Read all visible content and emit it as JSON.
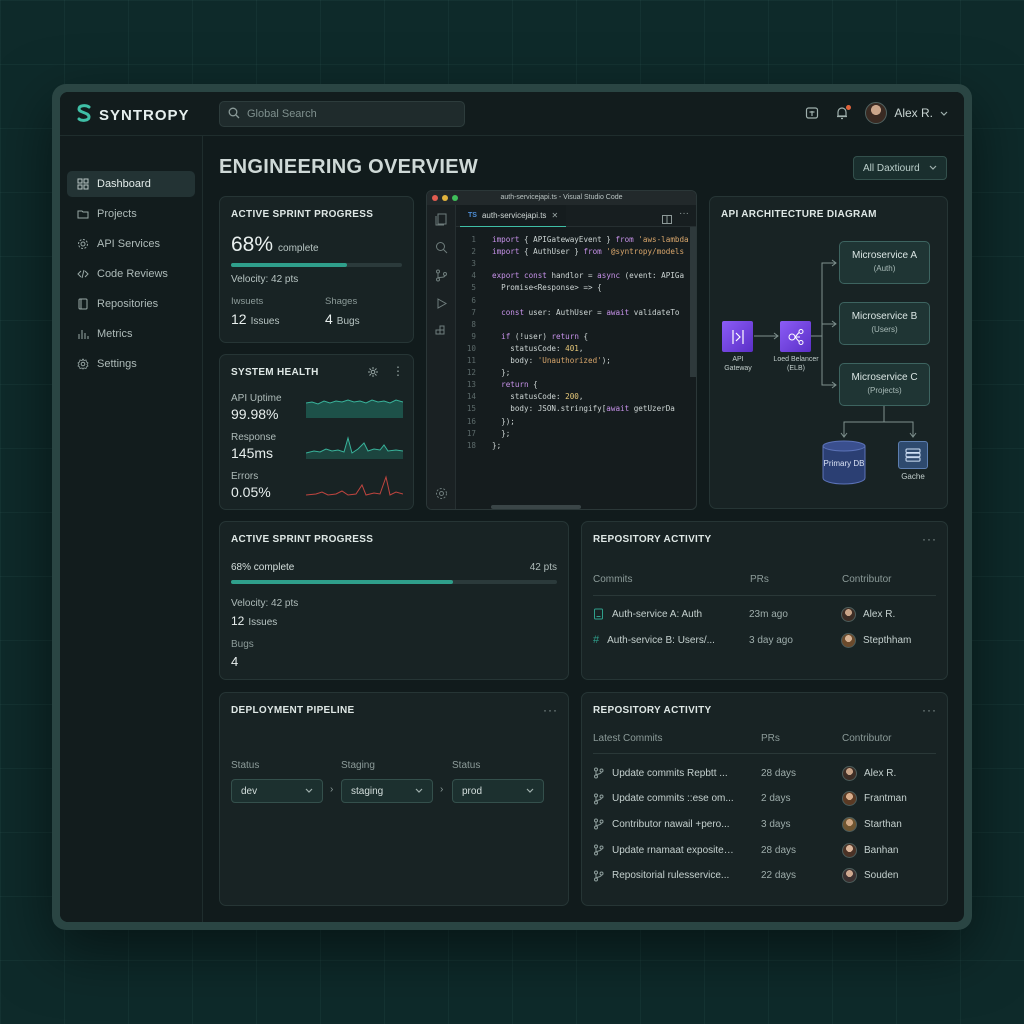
{
  "app": {
    "brand": "SYNTROPY",
    "search_placeholder": "Global Search",
    "user_name": "Alex R."
  },
  "sidebar": {
    "items": [
      {
        "label": "Dashboard",
        "icon": "grid-icon",
        "active": true
      },
      {
        "label": "Projects",
        "icon": "folder-icon"
      },
      {
        "label": "API Services",
        "icon": "gear-icon"
      },
      {
        "label": "Code Reviews",
        "icon": "code-icon"
      },
      {
        "label": "Repositories",
        "icon": "book-icon"
      },
      {
        "label": "Metrics",
        "icon": "bar-chart-icon"
      },
      {
        "label": "Settings",
        "icon": "settings-icon"
      }
    ]
  },
  "page": {
    "title": "ENGINEERING OVERVIEW",
    "dashboard_select": "All Daxtiourd"
  },
  "sprint_card": {
    "title": "ACTIVE SPRINT PROGRESS",
    "percent_label": "68%",
    "complete_label": "complete",
    "progress": 0.68,
    "velocity": "Velocity: 42 pts",
    "stat1_label": "Iwsuets",
    "stat1_value": "12",
    "stat1_unit": "Issues",
    "stat2_label": "Shages",
    "stat2_value": "4",
    "stat2_unit": "Bugs"
  },
  "health_card": {
    "title": "SYSTEM HEALTH",
    "metrics": [
      {
        "label": "API Uptime",
        "value": "99.98%",
        "color": "#2f9f8b"
      },
      {
        "label": "Response",
        "value": "145ms",
        "color": "#2f9f8b"
      },
      {
        "label": "Errors",
        "value": "0.05%",
        "color": "#c0453f"
      }
    ]
  },
  "code_editor": {
    "window_title": "auth-servicejapi.ts - Visual Studio Code",
    "tab_lang": "TS",
    "tab_label": "auth-servicejapi.ts",
    "lines": [
      {
        "n": "1",
        "t": "import { APIGatewayEvent } from 'aws-lambda"
      },
      {
        "n": "2",
        "t": "import { AuthUser } from '@syntropy/models"
      },
      {
        "n": "3",
        "t": ""
      },
      {
        "n": "4",
        "t": "export const handlor = async (event: APIGa"
      },
      {
        "n": "5",
        "t": "  Promise<Response> => {"
      },
      {
        "n": "6",
        "t": ""
      },
      {
        "n": "7",
        "t": "  const user: AuthUser = await validateTo"
      },
      {
        "n": "8",
        "t": ""
      },
      {
        "n": "9",
        "t": "  if (!user) return {"
      },
      {
        "n": "10",
        "t": "    statusCode: 401,"
      },
      {
        "n": "11",
        "t": "    body: 'Unauthorized');"
      },
      {
        "n": "12",
        "t": "  };"
      },
      {
        "n": "13",
        "t": "  return {"
      },
      {
        "n": "14",
        "t": "    statusCode: 200,"
      },
      {
        "n": "15",
        "t": "    body: JSON.stringify[await getUzerDa"
      },
      {
        "n": "16",
        "t": "  });"
      },
      {
        "n": "17",
        "t": "  };"
      },
      {
        "n": "18",
        "t": "};"
      }
    ]
  },
  "arch": {
    "title": "API ARCHITECTURE DIAGRAM",
    "gateway_label": "API Gateway",
    "lb_label": "Loed Belancer (ELB)",
    "services": [
      {
        "name": "Microservice A",
        "sub": "(Auth)"
      },
      {
        "name": "Microservice B",
        "sub": "(Users)"
      },
      {
        "name": "Microservice C",
        "sub": "(Projects)"
      }
    ],
    "db_label": "Primary DB",
    "cache_label": "Gache"
  },
  "sprint_wide": {
    "title": "ACTIVE SPRINT PROGRESS",
    "complete": "68% complete",
    "points": "42 pts",
    "progress": 0.68,
    "velocity": "Velocity: 42 pts",
    "issues_value": "12",
    "issues_unit": "Issues",
    "bugs_label": "Bugs",
    "bugs_value": "4"
  },
  "repo_activity_1": {
    "title": "REPOSITORY ACTIVITY",
    "headers": [
      "Commits",
      "PRs",
      "Contributor"
    ],
    "rows": [
      {
        "icon": "file-icon",
        "commit": "Auth-service A: Auth",
        "when": "23m ago",
        "user": "Alex R."
      },
      {
        "icon": "hash-icon",
        "commit": "Auth-service B: Users/...",
        "when": "3 day ago",
        "user": "Stepthham"
      }
    ]
  },
  "pipeline": {
    "title": "DEPLOYMENT PIPELINE",
    "stages": [
      {
        "label": "Status",
        "value": "dev"
      },
      {
        "label": "Staging",
        "value": "staging"
      },
      {
        "label": "Status",
        "value": "prod"
      }
    ]
  },
  "repo_activity_2": {
    "title": "REPOSITORY ACTIVITY",
    "headers": [
      "Latest Commits",
      "PRs",
      "Contributor"
    ],
    "rows": [
      {
        "commit": "Update commits  Repbtt ...",
        "when": "28 days",
        "user": "Alex R."
      },
      {
        "commit": "Update commits ::ese om...",
        "when": "2 days",
        "user": "Frantman"
      },
      {
        "commit": "Contributor nawail +pero...",
        "when": "3 days",
        "user": "Starthan"
      },
      {
        "commit": "Update rnamaat exposite…",
        "when": "28 days",
        "user": "Banhan"
      },
      {
        "commit": "Repositorial rulesservice...",
        "when": "22 days",
        "user": "Souden"
      }
    ]
  }
}
